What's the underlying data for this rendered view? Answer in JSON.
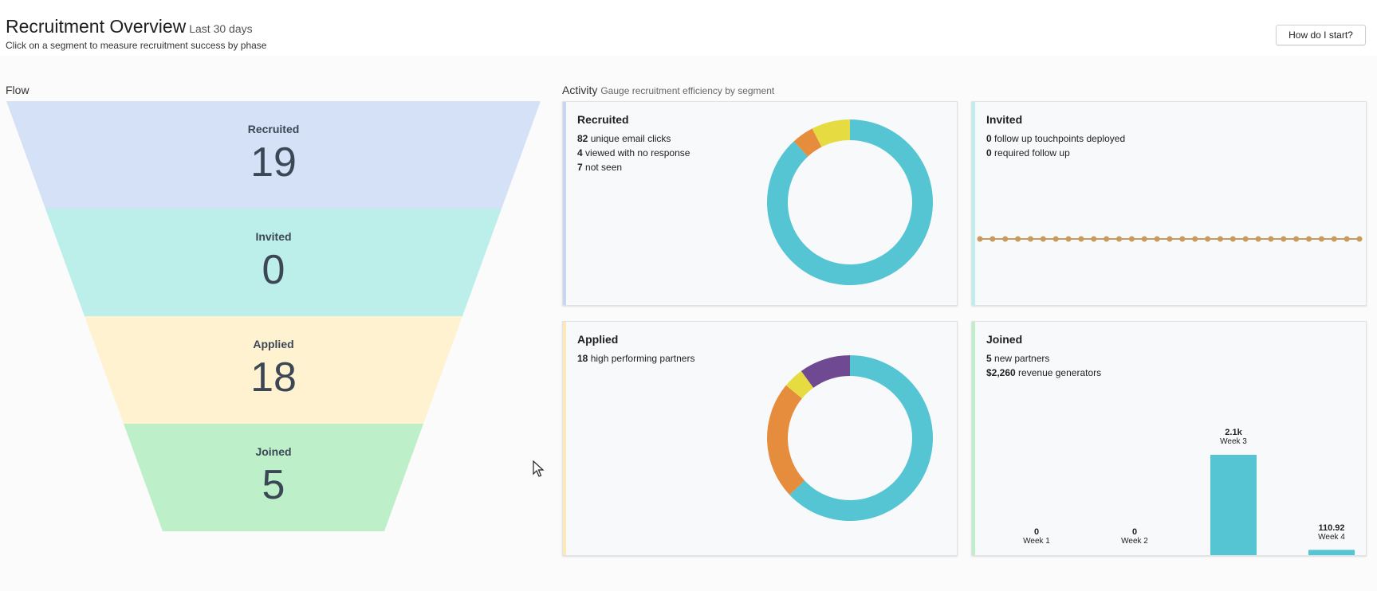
{
  "header": {
    "title": "Recruitment Overview",
    "range": "Last 30 days",
    "subtitle": "Click on a segment to measure recruitment success by phase",
    "help_button": "How do I start?"
  },
  "flow": {
    "label": "Flow",
    "stages": [
      {
        "label": "Recruited",
        "value": "19",
        "color": "#d5e1f7"
      },
      {
        "label": "Invited",
        "value": "0",
        "color": "#bdefea"
      },
      {
        "label": "Applied",
        "value": "18",
        "color": "#fff2d0"
      },
      {
        "label": "Joined",
        "value": "5",
        "color": "#bdf0c8"
      }
    ]
  },
  "activity": {
    "label": "Activity",
    "sublabel": "Gauge recruitment efficiency by segment",
    "cards": {
      "recruited": {
        "title": "Recruited",
        "accent": "#c8d6f2",
        "stats": [
          {
            "num": "82",
            "text": "unique email clicks"
          },
          {
            "num": "4",
            "text": "viewed with no response"
          },
          {
            "num": "7",
            "text": "not seen"
          }
        ]
      },
      "invited": {
        "title": "Invited",
        "accent": "#bdefea",
        "stats": [
          {
            "num": "0",
            "text": "follow up touchpoints deployed"
          },
          {
            "num": "0",
            "text": "required follow up"
          }
        ]
      },
      "applied": {
        "title": "Applied",
        "accent": "#fde9b8",
        "stats": [
          {
            "num": "18",
            "text": "high performing partners"
          }
        ]
      },
      "joined": {
        "title": "Joined",
        "accent": "#bdf0c8",
        "stats": [
          {
            "num": "5",
            "text": "new partners"
          },
          {
            "num": "$2,260",
            "text": "revenue generators"
          }
        ]
      }
    }
  },
  "colors": {
    "teal": "#55c4d3",
    "orange": "#e68c3d",
    "yellow": "#e6dc42",
    "purple": "#6f4a93",
    "line_dot": "#c89a5c"
  },
  "chart_data": [
    {
      "type": "pie",
      "name": "Recruited",
      "values": [
        82,
        4,
        7
      ],
      "colors": [
        "#55c4d3",
        "#e68c3d",
        "#e6dc42"
      ]
    },
    {
      "type": "line",
      "name": "Invited",
      "values": [
        0,
        0,
        0,
        0,
        0,
        0,
        0,
        0,
        0,
        0,
        0,
        0,
        0,
        0,
        0,
        0,
        0,
        0,
        0,
        0,
        0,
        0,
        0,
        0,
        0,
        0,
        0,
        0,
        0,
        0,
        0
      ]
    },
    {
      "type": "pie",
      "name": "Applied",
      "values": [
        63,
        23,
        4,
        10
      ],
      "colors": [
        "#55c4d3",
        "#e68c3d",
        "#e6dc42",
        "#6f4a93"
      ]
    },
    {
      "type": "bar",
      "name": "Joined",
      "categories": [
        "Week 1",
        "Week 2",
        "Week 3",
        "Week 4"
      ],
      "values": [
        0,
        0,
        2100,
        110.92
      ],
      "labels": [
        "0",
        "0",
        "2.1k",
        "110.92"
      ],
      "color": "#55c4d3"
    }
  ]
}
